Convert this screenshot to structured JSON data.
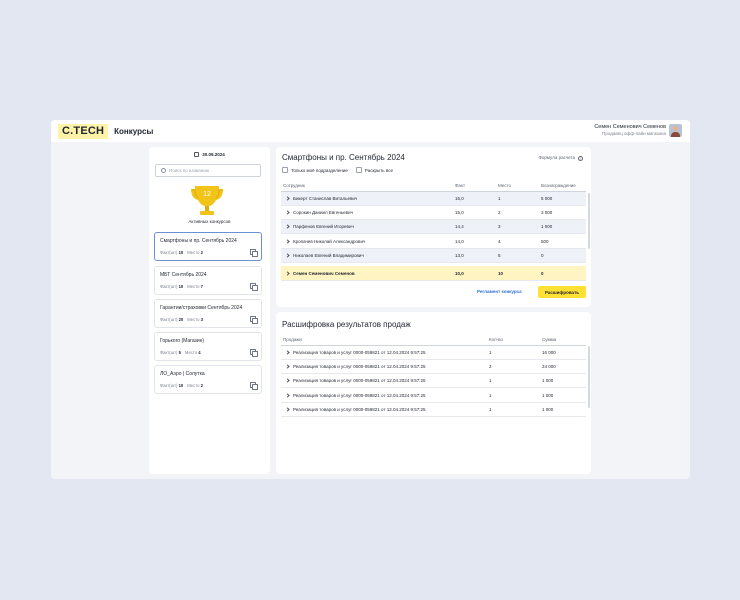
{
  "header": {
    "logo": "С.TECH",
    "title": "Конкурсы",
    "user_name": "Семен Семенович Семенов",
    "user_role": "Продавец офф-лайн магазина"
  },
  "sidebar": {
    "date": "30.09.2024",
    "search_placeholder": "Поиск по названию",
    "active_count": "12",
    "active_label": "Активных конкурсов",
    "fact_label": "Факт(шт)",
    "place_label": "Место",
    "contests": [
      {
        "title": "Смартфоны и пр. Сентябрь 2024",
        "fact": "10",
        "place": "2"
      },
      {
        "title": "МБТ Сентябрь 2024",
        "fact": "10",
        "place": "7"
      },
      {
        "title": "Гарантии/страховки Сентябрь 2024",
        "fact": "20",
        "place": "3"
      },
      {
        "title": "Горького (Магазин)",
        "fact": "5",
        "place": "4"
      },
      {
        "title": "ЛО_Аэро | Солутка",
        "fact": "10",
        "place": "2"
      }
    ]
  },
  "contest_panel": {
    "title": "Смартфоны и пр. Сентябрь 2024",
    "formula": "Формула расчета",
    "check_own": "Только моё подразделение",
    "check_expand": "Раскрыть все",
    "columns": [
      "Сотрудник",
      "Факт",
      "Место",
      "Вознаграждение"
    ],
    "rows": [
      [
        "Бикерт Станислав Витальевич",
        "15,0",
        "1",
        "5 000"
      ],
      [
        "Сорокин Даниил Евгеньевич",
        "15,0",
        "2",
        "3 000"
      ],
      [
        "Парфенов Евгений Игоревич",
        "14,4",
        "3",
        "1 000"
      ],
      [
        "Кропачев Николай Александрович",
        "14,0",
        "4",
        "500"
      ],
      [
        "Николаев Евгений Владимирович",
        "13,0",
        "5",
        "0"
      ]
    ],
    "me_row": [
      "Семен Семенович Семенов",
      "10,0",
      "10",
      "0"
    ],
    "reglament": "Регламент конкурса",
    "decode_button": "Расшифровать"
  },
  "sales_panel": {
    "title": "Расшифровка результатов продаж",
    "columns": [
      "Продажи",
      "Кол-во",
      "Сумма"
    ],
    "rows": [
      [
        "Реализация товаров и услуг 0000-059821 от 12.04.2024 9:57:25",
        "1",
        "16 000"
      ],
      [
        "Реализация товаров и услуг 0000-059821 от 12.04.2024 9:57:25",
        "2",
        "24 000"
      ],
      [
        "Реализация товаров и услуг 0000-059821 от 12.04.2024 9:57:25",
        "1",
        "1 000"
      ],
      [
        "Реализация товаров и услуг 0000-059821 от 12.04.2024 9:57:25",
        "1",
        "1 000"
      ],
      [
        "Реализация товаров и услуг 0000-059821 от 12.04.2024 9:57:25",
        "1",
        "1 000"
      ]
    ]
  },
  "colors": {
    "accent": "#ffe033",
    "logo_bg": "#fff3a8",
    "link": "#2f6fd6",
    "selected_border": "#6a90d6",
    "trophy": "#f2c418"
  }
}
